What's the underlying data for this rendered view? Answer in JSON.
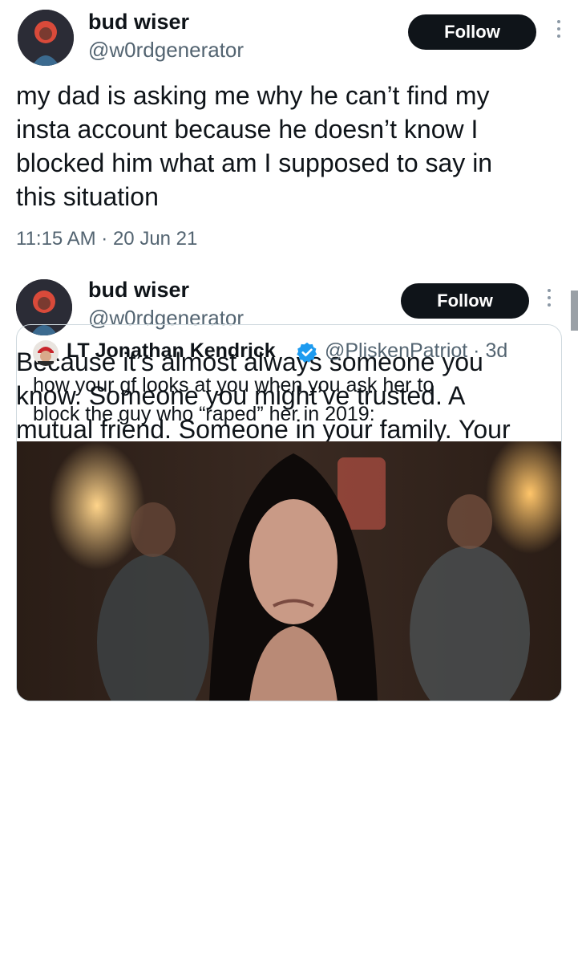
{
  "tweets": [
    {
      "author": {
        "name": "bud wiser",
        "handle": "@w0rdgenerator"
      },
      "follow_label": "Follow",
      "text": "my dad is asking me why he can’t find my\ninsta account because he doesn’t know I\nblocked him what am I supposed to say in\nthis situation",
      "timestamp": "11:15 AM · 20 Jun 21"
    },
    {
      "author": {
        "name": "bud wiser",
        "handle": "@w0rdgenerator"
      },
      "follow_label": "Follow",
      "text": "Because it’s almost always someone you\nknow. Someone you might’ve trusted. A\nmutual friend. Someone in your family. Your\nbest friend’s brother. People spend years\nconvincing you that what happened to you\nwasn’t even that bad, blocking doesn’t even\nenter the picture",
      "quote": {
        "author_name": "LT Jonathan Kendrick",
        "handle_time": "@PliskenPatriot · 3d",
        "text": "how your gf looks at you when you ask her to\nblock the guy who “raped” her in 2019:"
      }
    }
  ],
  "icons": {
    "more": "vertical-ellipsis-icon",
    "verified": "verified-badge-icon"
  },
  "colors": {
    "follow_button_bg": "#0f1419",
    "follow_button_text": "#ffffff",
    "secondary_text": "#536471",
    "verified_blue": "#1d9bf0",
    "border": "#cfd9de"
  }
}
